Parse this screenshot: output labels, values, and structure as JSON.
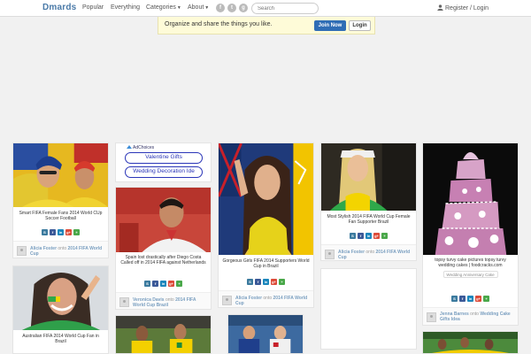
{
  "header": {
    "logo": "Dmards",
    "nav": {
      "popular": "Popular",
      "everything": "Everything",
      "categories": "Categories",
      "about": "About"
    },
    "social": {
      "fb": "f",
      "tw": "t",
      "gp": "g"
    },
    "search_placeholder": "Search",
    "register_login": "Register / Login"
  },
  "promo": {
    "text": "Organize and share the things you like.",
    "join": "Join Now",
    "login": "Login"
  },
  "share_icons": {
    "save": "S",
    "fb": "f",
    "in": "in",
    "gp": "g+",
    "share": "+"
  },
  "ad": {
    "label": "AdChoices",
    "button1": "Valentine Gifts",
    "button2": "Wedding Decoration Ide"
  },
  "pins": [
    {
      "caption": "Smart FIFA Female Fans 2014 World CUp Soccer Football",
      "user": "Alicia Foster",
      "board": "2014 FIFA World Cup"
    },
    {
      "caption": "Spain lost drastically after Diego Costa Called off in 2014 FIFA against Netherlands",
      "user": "Veronica Davis",
      "board": "2014 FIFA World Cup Brazil"
    },
    {
      "caption": "Gorgeous Girls FIFA 2014 Supporters World Cup in Brazil",
      "user": "Alicia Foster",
      "board": "2014 FIFA World Cup"
    },
    {
      "caption": "Most Stylish 2014 FIFA World Cup Female Fan Supporter Brazil",
      "user": "Alicia Foster",
      "board": "2014 FIFA World Cup"
    },
    {
      "caption": "topsy turvy cake pictures topsy turvy wedding cakes | foodcracks.com",
      "tag": "Wedding Anniversary Cake",
      "user": "Jenna Barnes",
      "board": "Wedding Cake Gifts Idea"
    },
    {
      "caption": "Australian FIFA 2014 World Cup Fan in Brazil"
    }
  ],
  "colors": {
    "brand": "#4a7aa8",
    "join_button": "#2f6db5",
    "promo_bg": "#fefbd8",
    "ad_border": "#2a35b8"
  }
}
